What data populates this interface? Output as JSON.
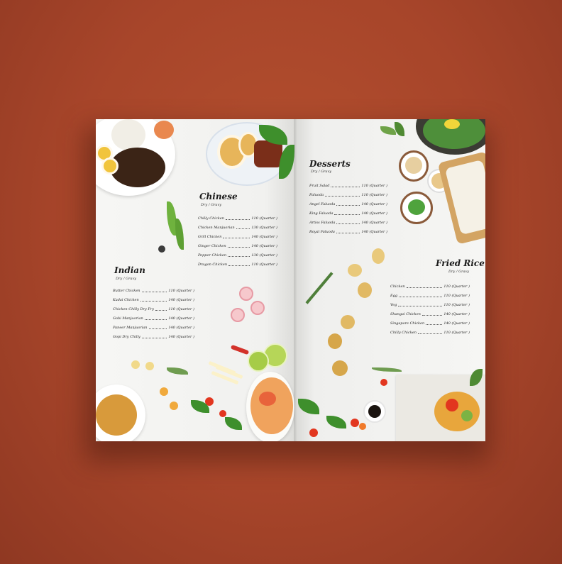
{
  "colors": {
    "background": "#a7452a",
    "paper": "#f4f4f2",
    "text": "#1b1b1b"
  },
  "chinese": {
    "title": "Chinese",
    "subtitle": "Dry / Gravy",
    "items": [
      {
        "name": "Chilly Chicken",
        "price": "110 (Quarter )"
      },
      {
        "name": "Chicken Manjuorian",
        "price": "130 (Quarter )"
      },
      {
        "name": "Grill Chicken",
        "price": "140 (Quarter )"
      },
      {
        "name": "Ginger Chicken",
        "price": "140 (Quarter )"
      },
      {
        "name": "Pepper Chicken",
        "price": "130 (Quarter )"
      },
      {
        "name": "Dragon Chicken",
        "price": "110 (Quarter )"
      }
    ]
  },
  "indian": {
    "title": "Indian",
    "subtitle": "Dry / Gravy",
    "items": [
      {
        "name": "Butter Chicken",
        "price": "110 (Quarter )"
      },
      {
        "name": "Kadai Chicken",
        "price": "140 (Quarter )"
      },
      {
        "name": "Chicken Chilly Dry Fry",
        "price": "110 (Quarter )"
      },
      {
        "name": "Gobi Manjuorian",
        "price": "140 (Quarter )"
      },
      {
        "name": "Paneer Manjuorian",
        "price": "140 (Quarter )"
      },
      {
        "name": "Gopi Dry Chilly",
        "price": "140 (Quarter )"
      }
    ]
  },
  "desserts": {
    "title": "Desserts",
    "subtitle": "Dry / Gravy",
    "items": [
      {
        "name": "Fruit Salad",
        "price": "110 (Quarter )"
      },
      {
        "name": "Faluoda",
        "price": "110 (Quarter )"
      },
      {
        "name": "Angel Faluoda",
        "price": "140 (Quarter )"
      },
      {
        "name": "King Faluoda",
        "price": "140 (Quarter )"
      },
      {
        "name": "Artiss Faluoda",
        "price": "140 (Quarter )"
      },
      {
        "name": "Royal Faluoda",
        "price": "140 (Quarter )"
      }
    ]
  },
  "fried_rice": {
    "title": "Fried Rice",
    "subtitle": "Dry / Gravy",
    "items": [
      {
        "name": "Chicken",
        "price": "110 (Quarter )"
      },
      {
        "name": "Egg",
        "price": "110 (Quarter )"
      },
      {
        "name": "Veg",
        "price": "110 (Quarter )"
      },
      {
        "name": "Shangai Chicken",
        "price": "140 (Quarter )"
      },
      {
        "name": "Singapore Chicken",
        "price": "140 (Quarter )"
      },
      {
        "name": "Chilly Chicken",
        "price": "110 (Quarter )"
      }
    ]
  }
}
